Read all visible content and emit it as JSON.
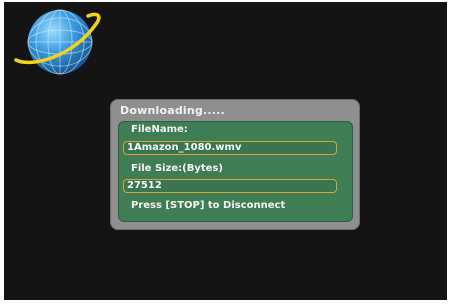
{
  "dialog": {
    "title": "Downloading.....",
    "filename_label": "FileName:",
    "filename_value": "1Amazon_1080.wmv",
    "filesize_label": "File Size:(Bytes)",
    "filesize_value": "27512",
    "hint": "Press [STOP] to Disconnect"
  },
  "colors": {
    "screen_background": "#141414",
    "dialog_frame": "#8f8f8f",
    "panel": "#3f7d55",
    "field_border": "#d6a438",
    "globe_blue": "#2f8fd6",
    "ring_yellow": "#f2d21c"
  },
  "icons": {
    "logo": "globe-with-orbit-ring-icon"
  }
}
